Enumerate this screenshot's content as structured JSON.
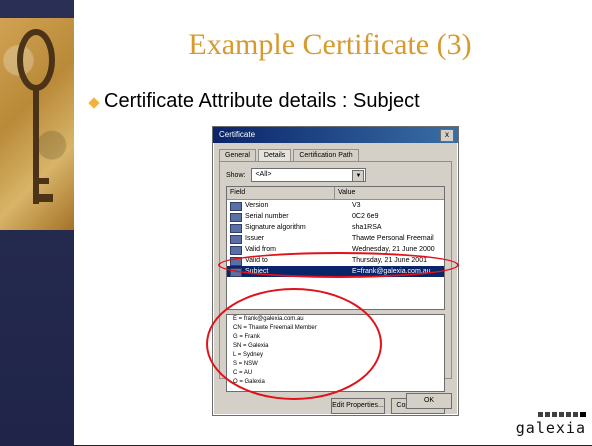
{
  "slide": {
    "title": "Example Certificate (3)",
    "bullet": "Certificate Attribute details : Subject"
  },
  "dialog": {
    "title": "Certificate",
    "close": "x",
    "tabs": [
      "General",
      "Details",
      "Certification Path"
    ],
    "active_tab": "Details",
    "show_label": "Show:",
    "show_value": "<All>",
    "columns": {
      "field": "Field",
      "value": "Value"
    },
    "rows": [
      {
        "field": "Version",
        "value": "V3"
      },
      {
        "field": "Serial number",
        "value": "0C2 6e9"
      },
      {
        "field": "Signature algorithm",
        "value": "sha1RSA"
      },
      {
        "field": "Issuer",
        "value": "Thawte Personal Freemail"
      },
      {
        "field": "Valid from",
        "value": "Wednesday, 21 June 2000"
      },
      {
        "field": "Valid to",
        "value": "Thursday, 21 June 2001"
      },
      {
        "field": "Subject",
        "value": "E=frank@galexia.com.au"
      }
    ],
    "details_lines": [
      "E = frank@galexia.com.au",
      "CN = Thawte Freemail Member",
      "G = Frank",
      "SN = Galexia",
      "L = Sydney",
      "S = NSW",
      "C = AU",
      "O = Galexia"
    ],
    "buttons": {
      "edit": "Edit Properties...",
      "copy": "Copy to File..."
    },
    "ok": "OK"
  },
  "logo": {
    "text": "galexia"
  }
}
